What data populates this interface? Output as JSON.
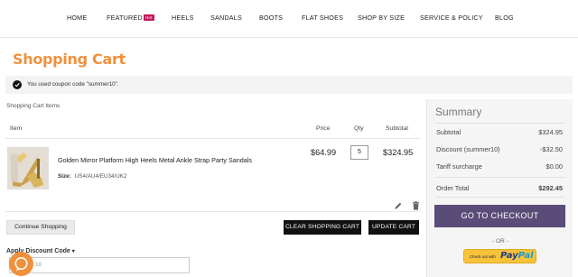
{
  "nav": {
    "items": [
      "HOME",
      "FEATURED",
      "HEELS",
      "SANDALS",
      "BOOTS",
      "FLAT SHOES",
      "SHOP BY SIZE",
      "SERVICE & POLICY",
      "BLOG"
    ],
    "hot_badge": "Hot"
  },
  "page": {
    "title": "Shopping Cart",
    "coupon_message": "You used coupon code \"summer10\"."
  },
  "cart": {
    "section_label": "Shopping Cart Items",
    "headers": {
      "item": "Item",
      "price": "Price",
      "qty": "Qty",
      "subtotal": "Subtotal"
    },
    "item": {
      "name": "Golden Mirror Platform High Heels Metal Ankle Strap Party Sandals",
      "size_label": "Size:",
      "size_value": "US4/AU4/EU34/UK2",
      "price": "$64.99",
      "qty": "5",
      "subtotal": "$324.95"
    },
    "continue_shopping": "Continue Shopping",
    "clear_cart": "CLEAR SHOPPING CART",
    "update_cart": "UPDATE CART",
    "discount_label": "Apply Discount Code",
    "discount_placeholder": "10"
  },
  "summary": {
    "title": "Summary",
    "rows": [
      {
        "label": "Subtotal",
        "value": "$324.95"
      },
      {
        "label": "Discount (summer10)",
        "value": "-$32.50"
      },
      {
        "label": "Tariff surcharge",
        "value": "$0.00"
      }
    ],
    "total_label": "Order Total",
    "total_value": "$292.45",
    "checkout": "GO TO CHECKOUT",
    "or": "- OR -",
    "paypal_small": "Check out with",
    "paypal_logo_a": "Pay",
    "paypal_logo_b": "Pal"
  },
  "colors": {
    "brand_orange": "#f0913c",
    "checkout_purple": "#5a4c78",
    "hot_badge": "#c2185b",
    "paypal_yellow": "#f7c33b"
  }
}
